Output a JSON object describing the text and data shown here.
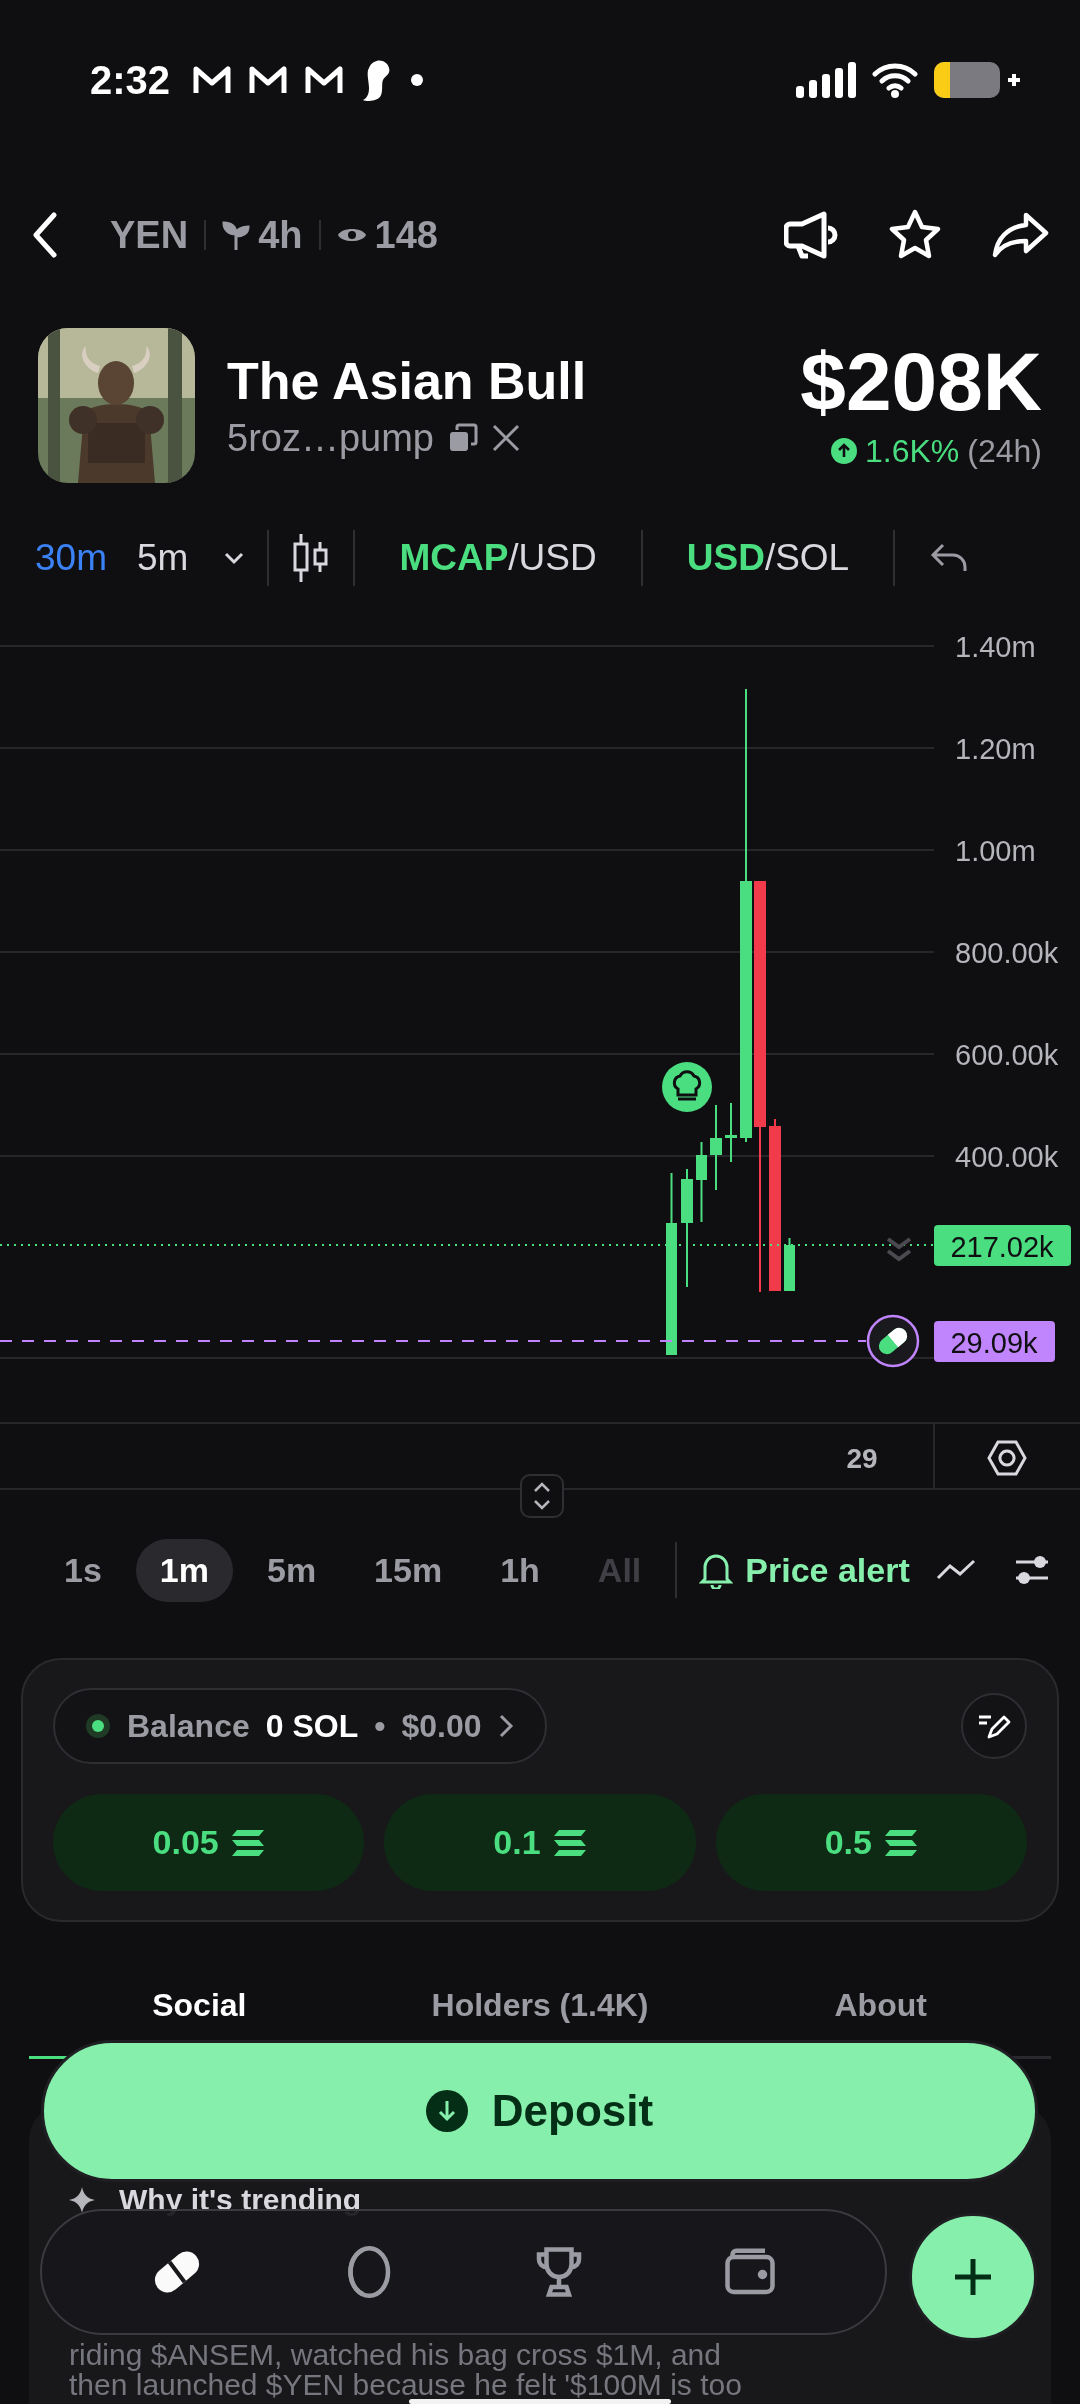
{
  "status_bar": {
    "time": "2:32"
  },
  "header": {
    "ticker": "YEN",
    "age": "4h",
    "views": "148"
  },
  "token": {
    "name": "The Asian Bull",
    "address": "5roz…pump",
    "price": "$208K",
    "change": "1.6K%",
    "period": "(24h)"
  },
  "chart_toolbar": {
    "intervals": [
      {
        "label": "30m",
        "selected": true
      },
      {
        "label": "5m",
        "selected": false
      }
    ],
    "pairs": [
      {
        "primary": "MCAP",
        "secondary": "/USD"
      },
      {
        "primary": "USD",
        "secondary": "/SOL"
      }
    ]
  },
  "chart": {
    "y_labels": [
      "1.40m",
      "1.20m",
      "1.00m",
      "800.00k",
      "600.00k",
      "400.00k"
    ],
    "last_price": "217.02k",
    "marker_price": "29.09k",
    "x_label": "29"
  },
  "timeframes": [
    {
      "label": "1s",
      "selected": false,
      "disabled": false
    },
    {
      "label": "1m",
      "selected": true,
      "disabled": false
    },
    {
      "label": "5m",
      "selected": false,
      "disabled": false
    },
    {
      "label": "15m",
      "selected": false,
      "disabled": false
    },
    {
      "label": "1h",
      "selected": false,
      "disabled": false
    },
    {
      "label": "All",
      "selected": false,
      "disabled": true
    }
  ],
  "price_alert": "Price alert",
  "balance": {
    "label": "Balance",
    "amount": "0 SOL",
    "separator": "•",
    "usd": "$0.00"
  },
  "quick_buys": [
    "0.05",
    "0.1",
    "0.5"
  ],
  "tabs": [
    {
      "label": "Social",
      "selected": true
    },
    {
      "label": "Holders (1.4K)",
      "selected": false
    },
    {
      "label": "About",
      "selected": false
    }
  ],
  "trending": {
    "title": "Why it's trending",
    "lines": [
      "riding $ANSEM, watched his bag cross $1M, and",
      "then launched $YEN because he felt '$100M is too"
    ]
  },
  "deposit": "Deposit",
  "nav": [
    {
      "kind": "pill",
      "selected": true
    },
    {
      "kind": "coin",
      "selected": false
    },
    {
      "kind": "trophy",
      "selected": false
    },
    {
      "kind": "wallet",
      "selected": false
    }
  ]
}
